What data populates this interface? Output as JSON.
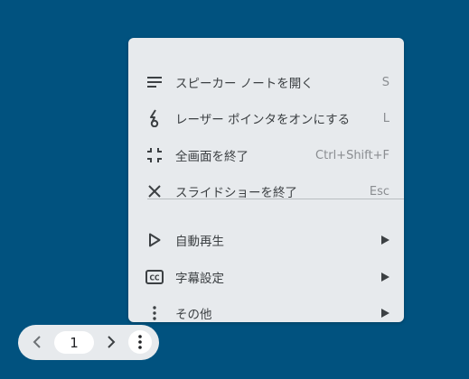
{
  "menu": {
    "items": [
      {
        "label": "スピーカー ノートを開く",
        "shortcut": "S",
        "icon": "notes-icon"
      },
      {
        "label": "レーザー ポインタをオンにする",
        "shortcut": "L",
        "icon": "laser-pointer-icon"
      },
      {
        "label": "全画面を終了",
        "shortcut": "Ctrl+Shift+F",
        "icon": "exit-fullscreen-icon"
      },
      {
        "label": "スライドショーを終了",
        "shortcut": "Esc",
        "icon": "close-icon"
      },
      {
        "label": "自動再生",
        "icon": "play-icon",
        "submenu": true
      },
      {
        "label": "字幕設定",
        "icon": "closed-captions-icon",
        "submenu": true
      },
      {
        "label": "その他",
        "icon": "more-vert-icon",
        "submenu": true
      }
    ]
  },
  "nav": {
    "page": "1",
    "prev_icon": "chevron-left-icon",
    "next_icon": "chevron-right-icon",
    "more_icon": "more-vert-icon"
  },
  "colors": {
    "background": "#01527f",
    "menu_bg": "#e7eaed",
    "text": "#3c4043",
    "shortcut": "#8a8d91"
  }
}
